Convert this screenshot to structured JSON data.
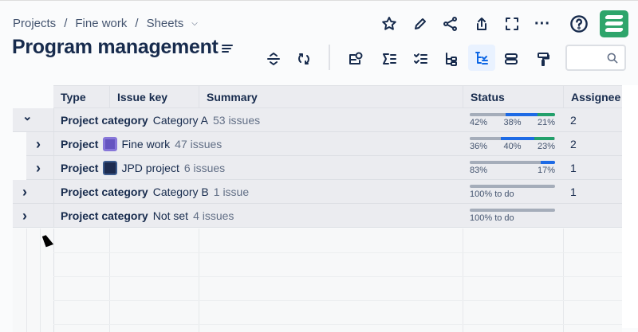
{
  "breadcrumb": [
    "Projects",
    "Fine work",
    "Sheets"
  ],
  "page_title": "Program management",
  "columns": [
    "Type",
    "Issue key",
    "Summary",
    "Status",
    "Assignee"
  ],
  "rows": [
    {
      "type": "Project category",
      "name": "Category A",
      "count": "53 issues",
      "status": [
        {
          "pct": "42%",
          "v": 42,
          "c": "#a5adba"
        },
        {
          "pct": "38%",
          "v": 38,
          "c": "#1d6ae5"
        },
        {
          "pct": "21%",
          "v": 21,
          "c": "#22a06b"
        }
      ],
      "assignee": "2",
      "expanded": true,
      "level": 0
    },
    {
      "type": "Project",
      "name": "Fine work",
      "count": "47 issues",
      "status": [
        {
          "pct": "36%",
          "v": 36,
          "c": "#a5adba"
        },
        {
          "pct": "40%",
          "v": 40,
          "c": "#1d6ae5"
        },
        {
          "pct": "23%",
          "v": 23,
          "c": "#22a06b"
        }
      ],
      "assignee": "2",
      "level": 1
    },
    {
      "type": "Project",
      "name": "JPD project",
      "count": "6 issues",
      "status": [
        {
          "pct": "83%",
          "v": 83,
          "c": "#a5adba"
        },
        {
          "pct": "17%",
          "v": 17,
          "c": "#1d6ae5"
        }
      ],
      "assignee": "1",
      "level": 1
    },
    {
      "type": "Project category",
      "name": "Category B",
      "count": "1 issue",
      "status_text": "100% to do",
      "assignee": "1",
      "level": 0
    },
    {
      "type": "Project category",
      "name": "Not set",
      "count": "4 issues",
      "status_text": "100% to do",
      "assignee": "",
      "level": 0
    }
  ]
}
